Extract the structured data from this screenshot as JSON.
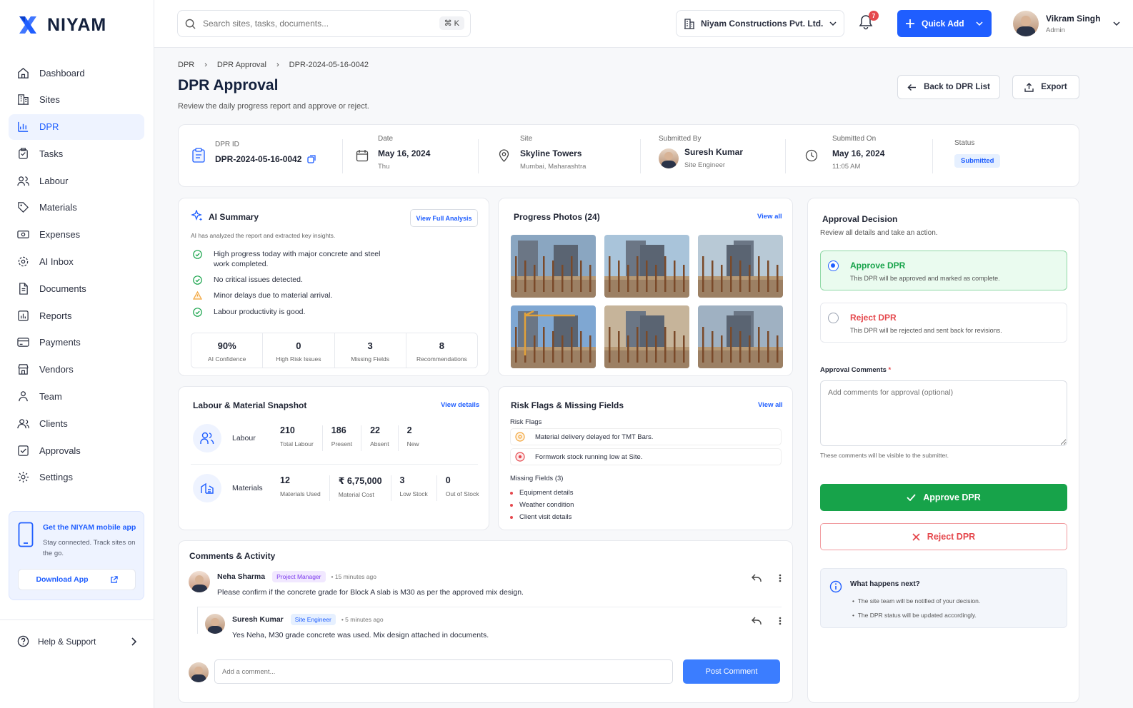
{
  "app": {
    "name": "NIYAM",
    "colors": {
      "primary": "#1f5eff",
      "success": "#17a34a",
      "danger": "#e5484d"
    }
  },
  "sidebar": {
    "items": [
      {
        "label": "Dashboard",
        "icon": "home-icon"
      },
      {
        "label": "Sites",
        "icon": "building-icon"
      },
      {
        "label": "DPR",
        "icon": "chart-icon",
        "active": true
      },
      {
        "label": "Tasks",
        "icon": "clipboard-icon"
      },
      {
        "label": "Labour",
        "icon": "users-icon"
      },
      {
        "label": "Materials",
        "icon": "tag-icon"
      },
      {
        "label": "Expenses",
        "icon": "cash-icon"
      },
      {
        "label": "AI Inbox",
        "icon": "ai-icon"
      },
      {
        "label": "Documents",
        "icon": "document-icon"
      },
      {
        "label": "Reports",
        "icon": "report-icon"
      },
      {
        "label": "Payments",
        "icon": "card-icon"
      },
      {
        "label": "Vendors",
        "icon": "store-icon"
      },
      {
        "label": "Team",
        "icon": "team-icon"
      },
      {
        "label": "Clients",
        "icon": "clients-icon"
      },
      {
        "label": "Approvals",
        "icon": "check-square-icon"
      },
      {
        "label": "Settings",
        "icon": "gear-icon"
      }
    ],
    "promo": {
      "title": "Get the NIYAM mobile app",
      "desc": "Stay connected. Track sites on the go.",
      "button": "Download App"
    },
    "help": "Help & Support"
  },
  "topbar": {
    "search_placeholder": "Search sites, tasks, documents...",
    "shortcut": "⌘ K",
    "company": "Niyam Constructions Pvt. Ltd.",
    "notifications": "7",
    "quick_add": "Quick Add",
    "user": {
      "name": "Vikram Singh",
      "role": "Admin"
    }
  },
  "page": {
    "breadcrumb": [
      "DPR",
      "DPR Approval",
      "DPR-2024-05-16-0042"
    ],
    "title": "DPR Approval",
    "subtitle": "Review the daily progress report and approve or reject.",
    "back_button": "Back to DPR List",
    "export_button": "Export"
  },
  "info": {
    "dpr_id_label": "DPR ID",
    "dpr_id": "DPR-2024-05-16-0042",
    "date_label": "Date",
    "date": "May 16, 2024",
    "day": "Thu",
    "site_label": "Site",
    "site": "Skyline Towers",
    "location": "Mumbai, Maharashtra",
    "submitted_by_label": "Submitted By",
    "submitted_by": "Suresh Kumar",
    "submitted_role": "Site Engineer",
    "submitted_on_label": "Submitted On",
    "submitted_on": "May 16, 2024",
    "submitted_time": "11:05 AM",
    "status_label": "Status",
    "status": "Submitted"
  },
  "ai": {
    "title": "AI Summary",
    "button": "View Full Analysis",
    "desc": "AI has analyzed the report and extracted key insights.",
    "items": [
      {
        "text": "High progress today with major concrete and steel work completed.",
        "type": "ok"
      },
      {
        "text": "No critical issues detected.",
        "type": "ok"
      },
      {
        "text": "Minor delays due to material arrival.",
        "type": "warn"
      },
      {
        "text": "Labour productivity is good.",
        "type": "ok"
      }
    ],
    "stats": [
      {
        "value": "90%",
        "label": "AI Confidence"
      },
      {
        "value": "0",
        "label": "High Risk Issues"
      },
      {
        "value": "3",
        "label": "Missing Fields"
      },
      {
        "value": "8",
        "label": "Recommendations"
      }
    ]
  },
  "photos": {
    "title": "Progress Photos (24)",
    "link": "View all"
  },
  "snapshot": {
    "title": "Labour & Material Snapshot",
    "link": "View details",
    "labour_label": "Labour",
    "labour": [
      {
        "value": "210",
        "label": "Total Labour"
      },
      {
        "value": "186",
        "label": "Present"
      },
      {
        "value": "22",
        "label": "Absent"
      },
      {
        "value": "2",
        "label": "New"
      }
    ],
    "materials_label": "Materials",
    "materials": [
      {
        "value": "12",
        "label": "Materials Used"
      },
      {
        "value": "₹ 6,75,000",
        "label": "Material Cost"
      },
      {
        "value": "3",
        "label": "Low Stock"
      },
      {
        "value": "0",
        "label": "Out of Stock"
      }
    ]
  },
  "risk": {
    "title": "Risk Flags & Missing Fields",
    "link": "View all",
    "flags_label": "Risk Flags",
    "flags": [
      "Material delivery delayed for TMT Bars.",
      "Formwork stock running low at Site."
    ],
    "missing_label": "Missing Fields (3)",
    "missing": [
      "Equipment details",
      "Weather condition",
      "Client visit details"
    ]
  },
  "comments": {
    "title": "Comments & Activity",
    "items": [
      {
        "name": "Neha Sharma",
        "role": "Project Manager",
        "time": "15 minutes ago",
        "text": "Please confirm if the concrete grade for Block A slab is M30 as per the approved mix design."
      },
      {
        "name": "Suresh Kumar",
        "role": "Site Engineer",
        "time": "5 minutes ago",
        "text": "Yes Neha, M30 grade concrete was used. Mix design attached in documents."
      }
    ],
    "input_placeholder": "Add a comment...",
    "post_button": "Post Comment"
  },
  "decision": {
    "title": "Approval Decision",
    "desc": "Review all details and take an action.",
    "approve_title": "Approve DPR",
    "approve_desc": "This DPR will be approved and marked as complete.",
    "reject_title": "Reject DPR",
    "reject_desc": "This DPR will be rejected and sent back for revisions.",
    "comments_label": "Approval Comments",
    "required_mark": "*",
    "comments_placeholder": "Add comments for approval (optional)",
    "comments_hint": "These comments will be visible to the submitter.",
    "approve_button": "Approve DPR",
    "reject_button": "Reject DPR",
    "next_title": "What happens next?",
    "next_items": [
      "The site team will be notified of your decision.",
      "The DPR status will be updated accordingly."
    ]
  }
}
